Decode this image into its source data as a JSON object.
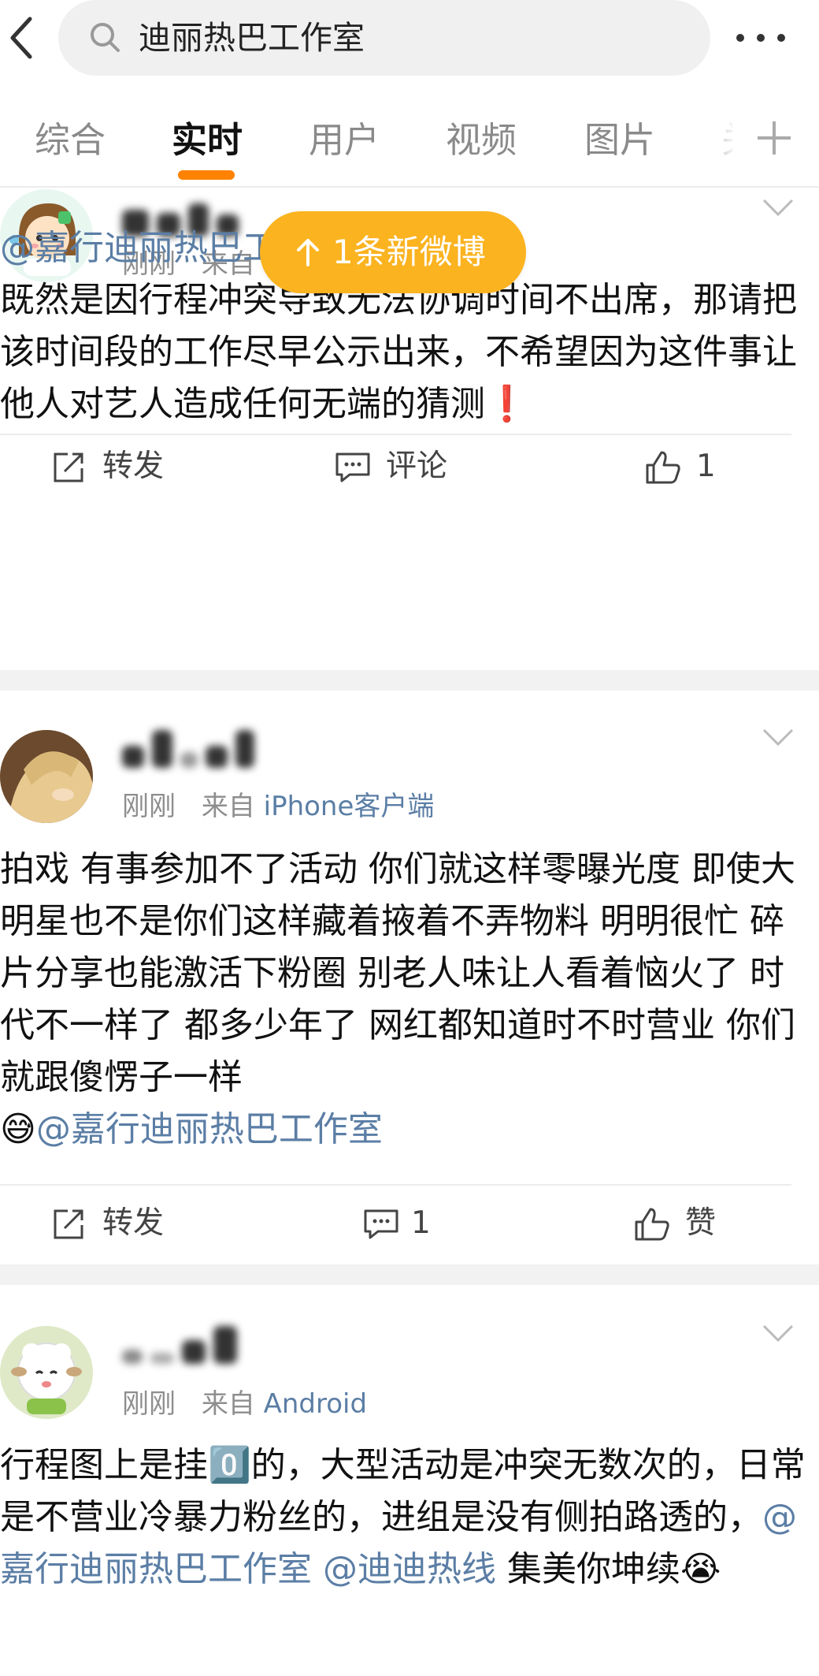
{
  "search": {
    "query": "迪丽热巴工作室"
  },
  "tabs": [
    {
      "label": "综合"
    },
    {
      "label": "实时"
    },
    {
      "label": "用户"
    },
    {
      "label": "视频"
    },
    {
      "label": "图片"
    },
    {
      "label": "关"
    }
  ],
  "new_posts_pill": {
    "label": "1条新微博"
  },
  "posts": [
    {
      "time": "刚刚",
      "source_prefix": "来自",
      "source": "",
      "mention": "@嘉行迪丽热巴工作室",
      "text": "既然是因行程冲突导致无法协调时间不出席，那请把该时间段的工作尽早公示出来，不希望因为这件事让他人对艺人造成任何无端的猜测",
      "emoji": "❗",
      "actions": {
        "repost": "转发",
        "comment": "评论",
        "like": "1"
      }
    },
    {
      "time": "刚刚",
      "source_prefix": "来自",
      "source": "iPhone客户端",
      "text": "拍戏 有事参加不了活动 你们就这样零曝光度 即使大明星也不是你们这样藏着掖着不弄物料 明明很忙 碎片分享也能激活下粉圈 别老人味让人看着恼火了 时代不一样了 都多少年了 网红都知道时不时营业 你们就跟傻愣子一样",
      "emoji": "😅",
      "mention": "@嘉行迪丽热巴工作室",
      "actions": {
        "repost": "转发",
        "comment": "1",
        "like": "赞"
      }
    },
    {
      "time": "刚刚",
      "source_prefix": "来自",
      "source": "Android",
      "text_a": "行程图上是挂",
      "emoji_a": "0️⃣",
      "text_b": "的，大型活动是冲突无数次的，日常是不营业冷暴力粉丝的，进组是没有侧拍路透的，",
      "mention_a": "@嘉行迪丽热巴工作室",
      "mention_b": "@迪迪热线",
      "text_c": " 集美你坤续",
      "emoji_c": "😭"
    }
  ],
  "colors": {
    "accent": "#ff8200",
    "pill": "#fbb31f",
    "link": "#5b7ea5",
    "muted": "#8e8e8e",
    "gap": "#f2f2f2"
  }
}
